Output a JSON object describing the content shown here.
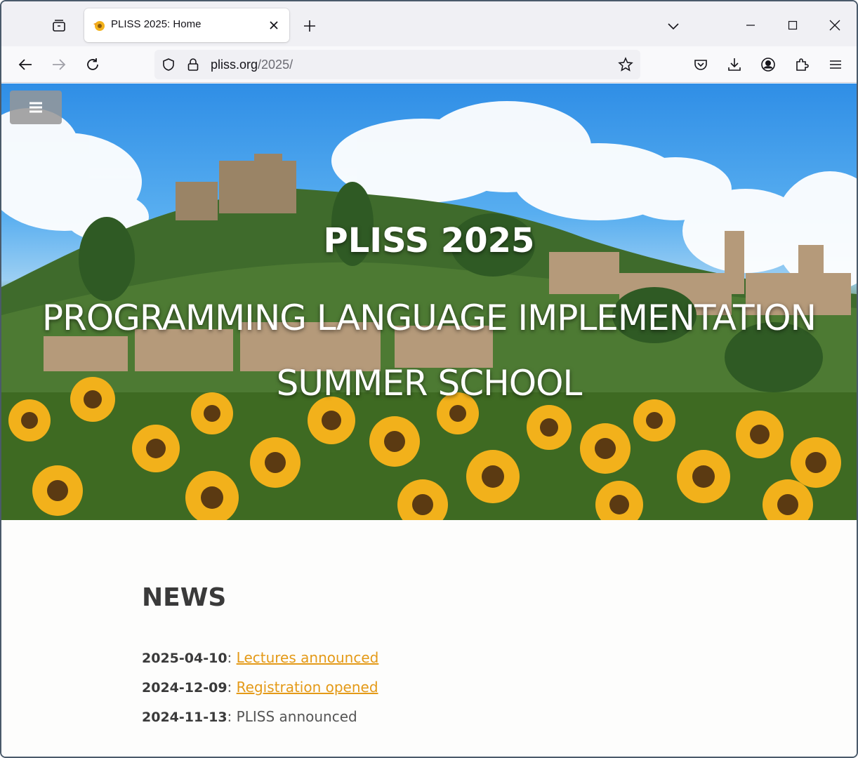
{
  "browser": {
    "tab": {
      "title": "PLISS 2025: Home"
    },
    "url": {
      "host": "pliss.org",
      "path": "/2025/"
    }
  },
  "hero": {
    "title": "PLISS 2025",
    "subtitle_line1": "PROGRAMMING LANGUAGE IMPLEMENTATION",
    "subtitle_line2": "SUMMER SCHOOL"
  },
  "news": {
    "heading": "NEWS",
    "items": [
      {
        "date": "2025-04-10",
        "separator": ": ",
        "text": "Lectures announced",
        "is_link": true
      },
      {
        "date": "2024-12-09",
        "separator": ": ",
        "text": "Registration opened",
        "is_link": true
      },
      {
        "date": "2024-11-13",
        "separator": ": ",
        "text": "PLISS announced",
        "is_link": false
      }
    ]
  },
  "colors": {
    "link": "#e49a18",
    "heading": "#3a3a3a",
    "tabstrip": "#f0f0f4"
  },
  "icons": {
    "tab_list": "tab-list-icon",
    "favicon": "pliss-favicon-icon",
    "tab_close": "close-icon",
    "new_tab": "plus-icon",
    "overflow": "chevron-down-icon",
    "back": "arrow-left-icon",
    "forward": "arrow-right-icon",
    "reload": "reload-icon",
    "shield": "shield-icon",
    "lock": "lock-icon",
    "bookmark": "star-icon",
    "pocket": "pocket-icon",
    "downloads": "download-icon",
    "account": "account-icon",
    "extensions": "puzzle-icon",
    "app_menu": "hamburger-icon",
    "site_menu": "hamburger-icon"
  }
}
